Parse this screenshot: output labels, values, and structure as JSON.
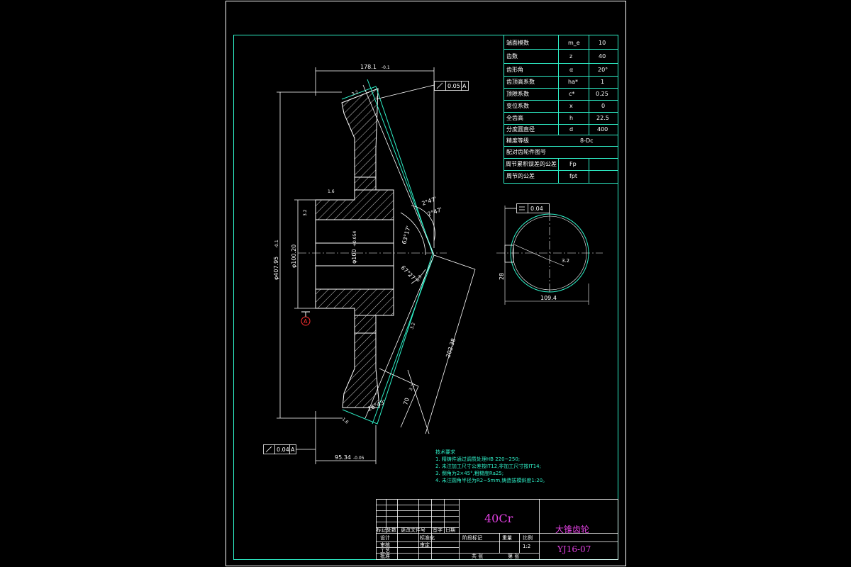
{
  "params": [
    {
      "name": "端面模数",
      "sym": "m_e",
      "val": "10"
    },
    {
      "name": "齿数",
      "sym": "z",
      "val": "40"
    },
    {
      "name": "齿形角",
      "sym": "α",
      "val": "20°"
    },
    {
      "name": "齿顶高系数",
      "sym": "ha*",
      "val": "1"
    },
    {
      "name": "顶隙系数",
      "sym": "c*",
      "val": "0.25"
    },
    {
      "name": "变位系数",
      "sym": "x",
      "val": "0"
    },
    {
      "name": "全齿高",
      "sym": "h",
      "val": "22.5"
    },
    {
      "name": "分度圆直径",
      "sym": "d",
      "val": "400"
    }
  ],
  "precision": {
    "name": "精度等级",
    "val": "8-Dc"
  },
  "mating": {
    "name": "配对齿轮件图号"
  },
  "tolerances": [
    {
      "name": "周节累积误差的公差",
      "val": "Fp"
    },
    {
      "name": "周节的公差",
      "val": "fpt"
    }
  ],
  "dims": {
    "top": "178.1",
    "top_tol": "-0.1",
    "runout_top": "0.05",
    "runout_bottom": "0.04",
    "flatness": "0.04",
    "datum": "A",
    "dia_outer": "φ407.95",
    "dia_outer_tol": "-0.1",
    "dia_mid": "φ100.20",
    "dia_bore": "φ100",
    "bore_tol": "+0.054",
    "bottom": "95.34",
    "bottom_tol": "-0.05",
    "cone_len": "202.38",
    "dim_70": "70",
    "ang_a": "2°47'",
    "ang_b": "2°47'",
    "ang_c": "63°17'",
    "ang_d": "67°27'",
    "ang_e": "26°43'",
    "keyway": "109.4",
    "keyway_width": "28",
    "sf_a": "3.2",
    "sf_b": "1.6",
    "sf_c": "3.2",
    "sf_d": "3.2",
    "sf_e": "1.6",
    "sf_f": "6.3",
    "sf_g": "3.2"
  },
  "notes": {
    "title": "技术要求",
    "lines": [
      "1. 精铸件通过调质处理HB 220~250;",
      "2. 未注加工尺寸公差按IT12,非加工尺寸按IT14;",
      "3. 倒角为2×45°,粗糙度Ra25;",
      "4. 未注圆角半径为R2~5mm,铸造拔模斜度1:20。"
    ]
  },
  "titleblock": {
    "material": "40Cr",
    "part_name": "大锥齿轮",
    "drawing_no": "YJ16-07",
    "scale": "1:2",
    "h_mark": "标记",
    "h_count": "处数",
    "h_zone": "分区",
    "h_file": "更改文件号",
    "h_sign": "签字",
    "h_date": "日期",
    "design": "设计",
    "std": "标准化",
    "check": "审核",
    "process": "工艺",
    "approve": "批准",
    "review": "审定",
    "stage": "阶段标记",
    "weight": "重量",
    "scale_label": "比例",
    "sheets_total": "共 张",
    "sheet_no": "第 张"
  }
}
